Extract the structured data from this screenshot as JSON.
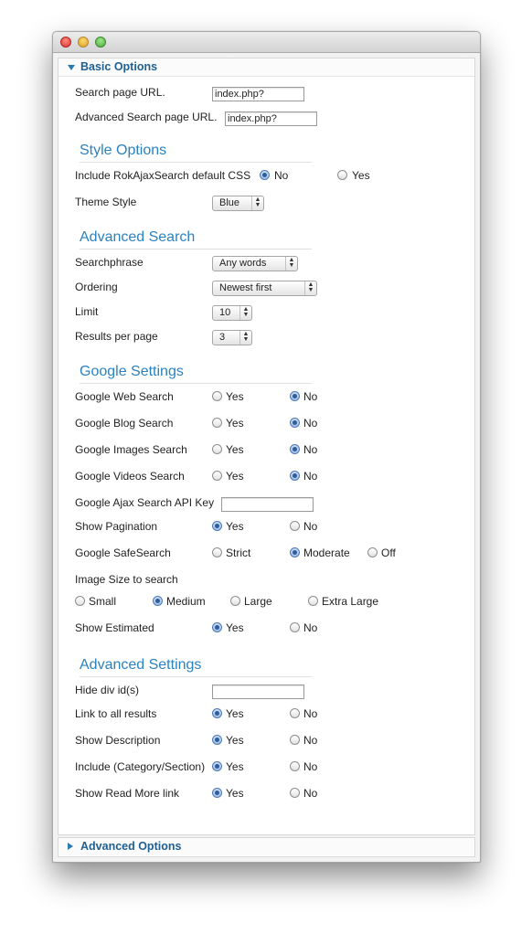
{
  "panels": {
    "basic_title": "Basic Options",
    "advanced_title": "Advanced Options"
  },
  "fields": {
    "search_url_label": "Search page URL.",
    "search_url_value": "index.php?option=c",
    "adv_search_url_label": "Advanced Search page URL.",
    "adv_search_url_value": "index.php?option=c"
  },
  "sections": {
    "style": "Style Options",
    "advanced_search": "Advanced Search",
    "google": "Google Settings",
    "advanced_settings": "Advanced Settings"
  },
  "style": {
    "css_label": "Include RokAjaxSearch default CSS",
    "css_no": "No",
    "css_yes": "Yes",
    "theme_label": "Theme Style",
    "theme_value": "Blue"
  },
  "adv_search": {
    "searchphrase_label": "Searchphrase",
    "searchphrase_value": "Any words",
    "ordering_label": "Ordering",
    "ordering_value": "Newest first",
    "limit_label": "Limit",
    "limit_value": "10",
    "results_label": "Results per page",
    "results_value": "3"
  },
  "google": {
    "web_label": "Google Web Search",
    "blog_label": "Google Blog Search",
    "images_label": "Google Images Search",
    "videos_label": "Google Videos Search",
    "api_key_label": "Google Ajax Search API Key",
    "api_key_value": "",
    "pagination_label": "Show Pagination",
    "safesearch_label": "Google SafeSearch",
    "safe_strict": "Strict",
    "safe_moderate": "Moderate",
    "safe_off": "Off",
    "imgsize_label": "Image Size to search",
    "size_small": "Small",
    "size_medium": "Medium",
    "size_large": "Large",
    "size_xlarge": "Extra Large",
    "estimated_label": "Show Estimated"
  },
  "adv_settings": {
    "hide_div_label": "Hide div id(s)",
    "hide_div_value": "",
    "link_all_label": "Link to all results",
    "desc_label": "Show Description",
    "cat_label": "Include (Category/Section)",
    "readmore_label": "Show Read More link"
  },
  "common": {
    "yes": "Yes",
    "no": "No"
  }
}
